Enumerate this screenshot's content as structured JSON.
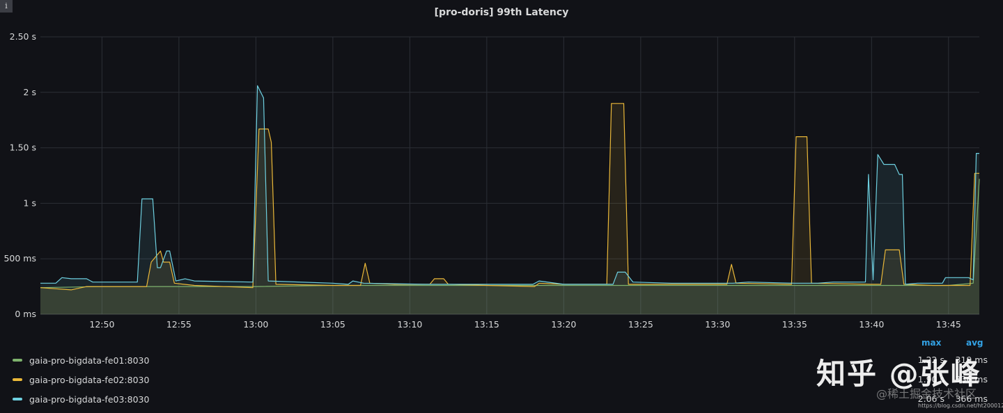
{
  "panel": {
    "title": "[pro-doris] 99th Latency",
    "info_icon": "i"
  },
  "chart_data": {
    "type": "area",
    "title": "[pro-doris] 99th Latency",
    "xlabel": "",
    "ylabel": "",
    "ylim": [
      0,
      2.5
    ],
    "yunit": "s",
    "yticks": [
      "0 ms",
      "500 ms",
      "1 s",
      "1.50 s",
      "2 s",
      "2.50 s"
    ],
    "ytick_values": [
      0,
      0.5,
      1,
      1.5,
      2,
      2.5
    ],
    "xlim": [
      "12:46",
      "13:47"
    ],
    "xticks": [
      "12:50",
      "12:55",
      "13:00",
      "13:05",
      "13:10",
      "13:15",
      "13:20",
      "13:25",
      "13:30",
      "13:35",
      "13:40",
      "13:45"
    ],
    "grid": true,
    "legend_placement": "bottom",
    "legend_columns": [
      "max",
      "avg"
    ],
    "series": [
      {
        "name": "gaia-pro-bigdata-fe01:8030",
        "color": "#7eb26d",
        "max": "1.22 s",
        "avg": "319 ms",
        "points": [
          [
            "12:46",
            0.24
          ],
          [
            "12:50",
            0.25
          ],
          [
            "12:55",
            0.25
          ],
          [
            "13:00",
            0.25
          ],
          [
            "13:05",
            0.26
          ],
          [
            "13:10",
            0.26
          ],
          [
            "13:15",
            0.26
          ],
          [
            "13:20",
            0.26
          ],
          [
            "13:25",
            0.26
          ],
          [
            "13:30",
            0.26
          ],
          [
            "13:35",
            0.26
          ],
          [
            "13:40",
            0.26
          ],
          [
            "13:45",
            0.26
          ],
          [
            "13:46.6",
            0.28
          ],
          [
            "13:47",
            1.22
          ]
        ]
      },
      {
        "name": "gaia-pro-bigdata-fe02:8030",
        "color": "#eab839",
        "max": "1.90 s",
        "avg": "336 ms",
        "points": [
          [
            "12:46",
            0.24
          ],
          [
            "12:48",
            0.22
          ],
          [
            "12:49",
            0.25
          ],
          [
            "12:52",
            0.25
          ],
          [
            "12:52.9",
            0.25
          ],
          [
            "12:53.2",
            0.47
          ],
          [
            "12:53.8",
            0.57
          ],
          [
            "12:54",
            0.47
          ],
          [
            "12:54.4",
            0.47
          ],
          [
            "12:54.7",
            0.28
          ],
          [
            "12:56",
            0.26
          ],
          [
            "12:59.8",
            0.24
          ],
          [
            "13:00.2",
            1.67
          ],
          [
            "13:00.8",
            1.67
          ],
          [
            "13:01",
            1.55
          ],
          [
            "13:01.3",
            0.27
          ],
          [
            "13:05",
            0.26
          ],
          [
            "13:06.8",
            0.26
          ],
          [
            "13:07.1",
            0.46
          ],
          [
            "13:07.4",
            0.28
          ],
          [
            "13:09",
            0.27
          ],
          [
            "13:11.3",
            0.27
          ],
          [
            "13:11.6",
            0.32
          ],
          [
            "13:12.2",
            0.32
          ],
          [
            "13:12.5",
            0.27
          ],
          [
            "13:15",
            0.26
          ],
          [
            "13:18.1",
            0.25
          ],
          [
            "13:18.4",
            0.28
          ],
          [
            "13:20",
            0.27
          ],
          [
            "13:22.8",
            0.27
          ],
          [
            "13:23.1",
            1.9
          ],
          [
            "13:23.9",
            1.9
          ],
          [
            "13:24.2",
            0.27
          ],
          [
            "13:27",
            0.27
          ],
          [
            "13:30.6",
            0.27
          ],
          [
            "13:30.9",
            0.45
          ],
          [
            "13:31.2",
            0.28
          ],
          [
            "13:34.8",
            0.27
          ],
          [
            "13:35.1",
            1.6
          ],
          [
            "13:35.8",
            1.6
          ],
          [
            "13:36.1",
            0.28
          ],
          [
            "13:40",
            0.27
          ],
          [
            "13:40.6",
            0.27
          ],
          [
            "13:40.9",
            0.58
          ],
          [
            "13:41.8",
            0.58
          ],
          [
            "13:42.1",
            0.27
          ],
          [
            "13:44",
            0.26
          ],
          [
            "13:46.4",
            0.26
          ],
          [
            "13:46.7",
            1.27
          ],
          [
            "13:47",
            1.27
          ]
        ]
      },
      {
        "name": "gaia-pro-bigdata-fe03:8030",
        "color": "#6ed0e0",
        "max": "2.06 s",
        "avg": "366 ms",
        "points": [
          [
            "12:46",
            0.28
          ],
          [
            "12:47",
            0.28
          ],
          [
            "12:47.4",
            0.33
          ],
          [
            "12:48",
            0.32
          ],
          [
            "12:49",
            0.32
          ],
          [
            "12:49.4",
            0.29
          ],
          [
            "12:51",
            0.29
          ],
          [
            "12:52.3",
            0.29
          ],
          [
            "12:52.6",
            1.04
          ],
          [
            "12:53.3",
            1.04
          ],
          [
            "12:53.6",
            0.42
          ],
          [
            "12:53.8",
            0.42
          ],
          [
            "12:54.2",
            0.57
          ],
          [
            "12:54.4",
            0.57
          ],
          [
            "12:54.8",
            0.3
          ],
          [
            "12:55.4",
            0.32
          ],
          [
            "12:56",
            0.3
          ],
          [
            "12:59.8",
            0.29
          ],
          [
            "13:00.1",
            2.06
          ],
          [
            "13:00.5",
            1.95
          ],
          [
            "13:00.8",
            0.3
          ],
          [
            "13:05",
            0.28
          ],
          [
            "13:06",
            0.27
          ],
          [
            "13:06.3",
            0.3
          ],
          [
            "13:07",
            0.28
          ],
          [
            "13:11",
            0.27
          ],
          [
            "13:15",
            0.27
          ],
          [
            "13:18",
            0.27
          ],
          [
            "13:18.4",
            0.3
          ],
          [
            "13:20",
            0.27
          ],
          [
            "13:22",
            0.27
          ],
          [
            "13:23.2",
            0.27
          ],
          [
            "13:23.5",
            0.38
          ],
          [
            "13:24",
            0.38
          ],
          [
            "13:24.5",
            0.29
          ],
          [
            "13:27",
            0.28
          ],
          [
            "13:29",
            0.28
          ],
          [
            "13:30",
            0.28
          ],
          [
            "13:31",
            0.28
          ],
          [
            "13:32",
            0.29
          ],
          [
            "13:35",
            0.28
          ],
          [
            "13:36.5",
            0.28
          ],
          [
            "13:37.5",
            0.29
          ],
          [
            "13:39.6",
            0.29
          ],
          [
            "13:39.8",
            1.26
          ],
          [
            "13:40.1",
            0.31
          ],
          [
            "13:40.4",
            1.44
          ],
          [
            "13:40.8",
            1.35
          ],
          [
            "13:41.5",
            1.35
          ],
          [
            "13:41.8",
            1.26
          ],
          [
            "13:42",
            1.26
          ],
          [
            "13:42.2",
            0.27
          ],
          [
            "13:43",
            0.28
          ],
          [
            "13:44.6",
            0.28
          ],
          [
            "13:44.8",
            0.33
          ],
          [
            "13:46.3",
            0.33
          ],
          [
            "13:46.6",
            0.31
          ],
          [
            "13:46.8",
            1.45
          ],
          [
            "13:47",
            1.45
          ]
        ]
      }
    ]
  },
  "watermark": {
    "logo": "知乎 @张峰",
    "sub": "@稀土掘金技术社区",
    "url": "https://blog.csdn.net/ht200012"
  }
}
